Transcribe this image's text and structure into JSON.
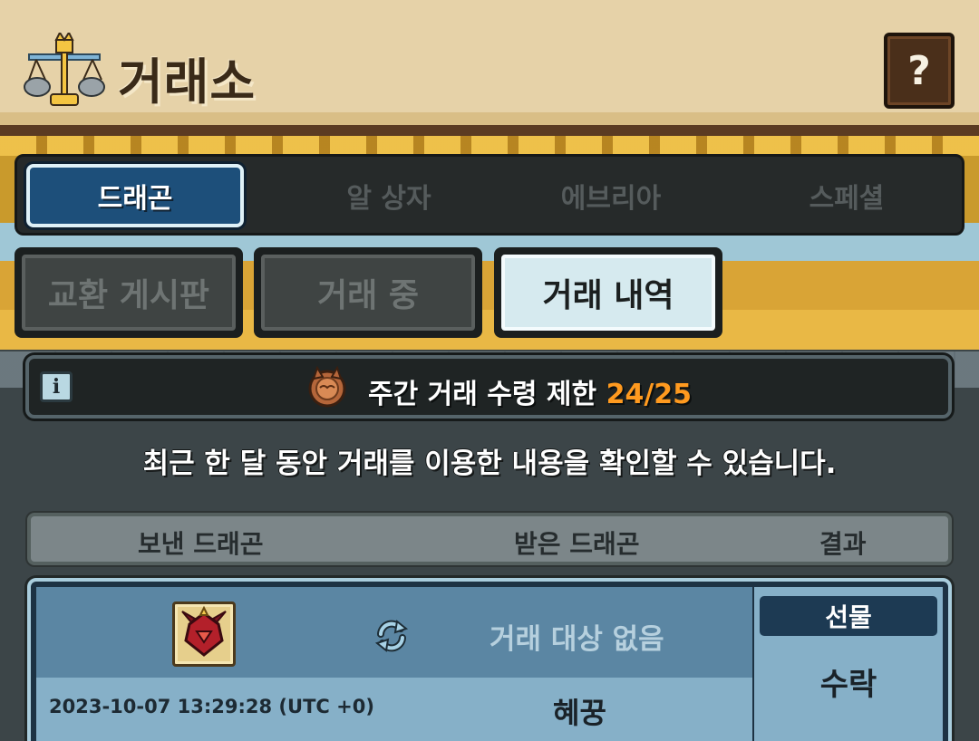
{
  "header": {
    "title": "거래소",
    "help_label": "?"
  },
  "top_tabs": [
    {
      "label": "드래곤",
      "active": true
    },
    {
      "label": "알 상자",
      "active": false
    },
    {
      "label": "에브리아",
      "active": false
    },
    {
      "label": "스페셜",
      "active": false
    }
  ],
  "sub_tabs": [
    {
      "label": "교환 게시판",
      "active": false
    },
    {
      "label": "거래 중",
      "active": false
    },
    {
      "label": "거래 내역",
      "active": true
    }
  ],
  "limit": {
    "info_label": "i",
    "label": "주간 거래 수령 제한",
    "count": "24/25"
  },
  "notice": "최근 한 달 동안 거래를 이용한 내용을 확인할 수 있습니다.",
  "table_header": {
    "sent": "보낸 드래곤",
    "received": "받은 드래곤",
    "result": "결과"
  },
  "records": [
    {
      "sent_item_icon": "red-dragon-icon",
      "received": "거래 대상 없음",
      "timestamp": "2023-10-07 13:29:28 (UTC +0)",
      "partner": "혜꿍",
      "type_badge": "선물",
      "result": "수락"
    }
  ],
  "colors": {
    "active_tab": "#1d4f7a",
    "limit_count": "#ff9a1f",
    "record_bg": "#5b86a3"
  }
}
